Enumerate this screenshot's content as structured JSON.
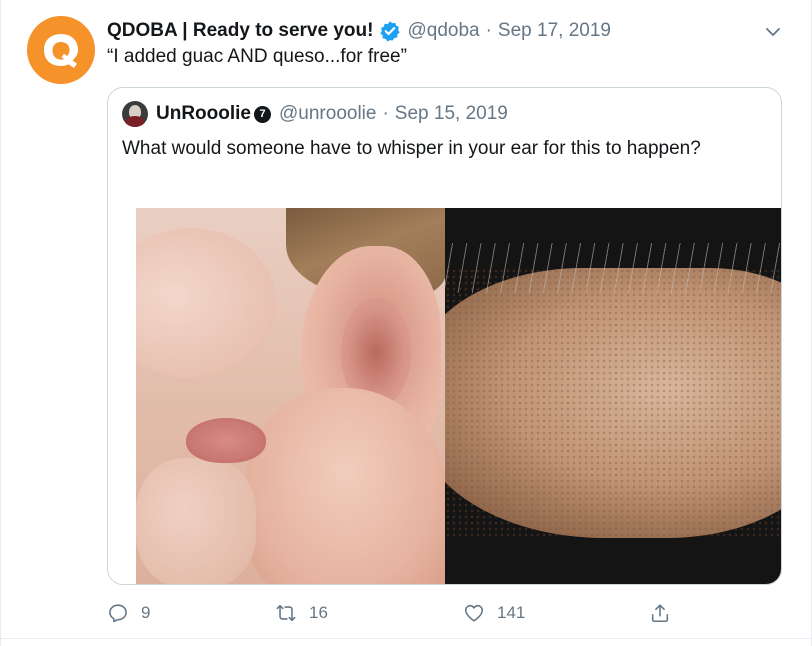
{
  "tweet": {
    "author": {
      "display_name": "QDOBA | Ready to serve you!",
      "verified": true,
      "handle": "@qdoba",
      "avatar_icon": "qdoba-logo",
      "avatar_color": "#f6922a"
    },
    "separator": "·",
    "date": "Sep 17, 2019",
    "text": "“I added guac AND queso...for free”",
    "menu_icon": "chevron-down-icon",
    "quoted": {
      "author": {
        "display_name": "UnRooolie",
        "badge": "7",
        "handle": "@unrooolie"
      },
      "separator": "·",
      "date": "Sep 15, 2019",
      "text": "What would someone have to whisper in your ear for this to happen?",
      "media": [
        {
          "type": "photo",
          "subject": "whisper-into-ear"
        },
        {
          "type": "photo",
          "subject": "goosebumps-arm"
        }
      ]
    },
    "actions": {
      "reply_count": "9",
      "retweet_count": "16",
      "like_count": "141",
      "share_icon": "share-icon"
    }
  },
  "colors": {
    "text": "#14171a",
    "secondary": "#657786",
    "verified": "#1da1f2",
    "border": "#ccd6dd"
  }
}
